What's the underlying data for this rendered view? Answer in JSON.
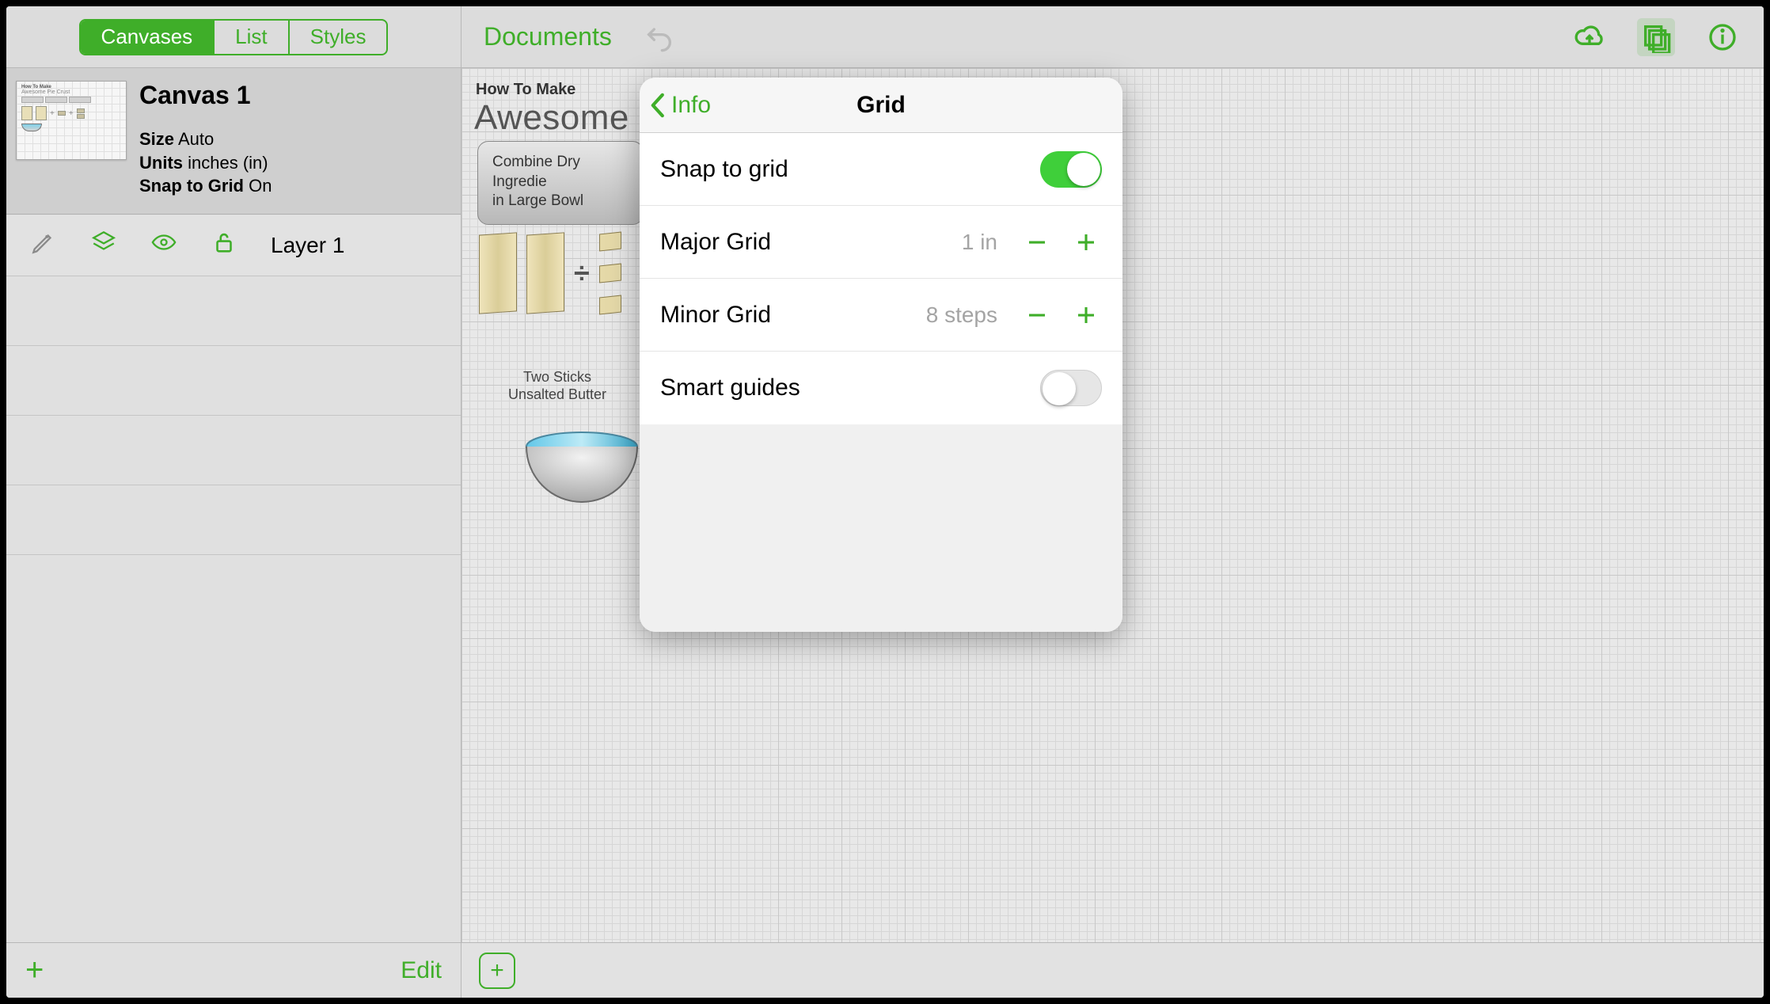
{
  "sidebar": {
    "segments": {
      "canvases": "Canvases",
      "list": "List",
      "styles": "Styles"
    },
    "canvas": {
      "title": "Canvas 1",
      "size_label": "Size",
      "size_value": "Auto",
      "units_label": "Units",
      "units_value": "inches (in)",
      "snap_label": "Snap to Grid",
      "snap_value": "On"
    },
    "layer": {
      "name": "Layer 1"
    },
    "footer": {
      "edit": "Edit"
    }
  },
  "toolbar": {
    "documents": "Documents"
  },
  "canvas_doc": {
    "subtitle": "How To Make",
    "title": "Awesome P",
    "combine": "Combine Dry Ingredie\nin Large Bowl",
    "combine_line1": "Combine Dry Ingredie",
    "combine_line2": "in Large Bowl",
    "butter_line1": "Two Sticks",
    "butter_line2": "Unsalted Butter"
  },
  "popover": {
    "back": "Info",
    "title": "Grid",
    "rows": {
      "snap": {
        "label": "Snap to grid",
        "on": true
      },
      "major": {
        "label": "Major Grid",
        "value": "1 in"
      },
      "minor": {
        "label": "Minor Grid",
        "value": "8 steps"
      },
      "smart": {
        "label": "Smart guides",
        "on": false
      }
    }
  }
}
